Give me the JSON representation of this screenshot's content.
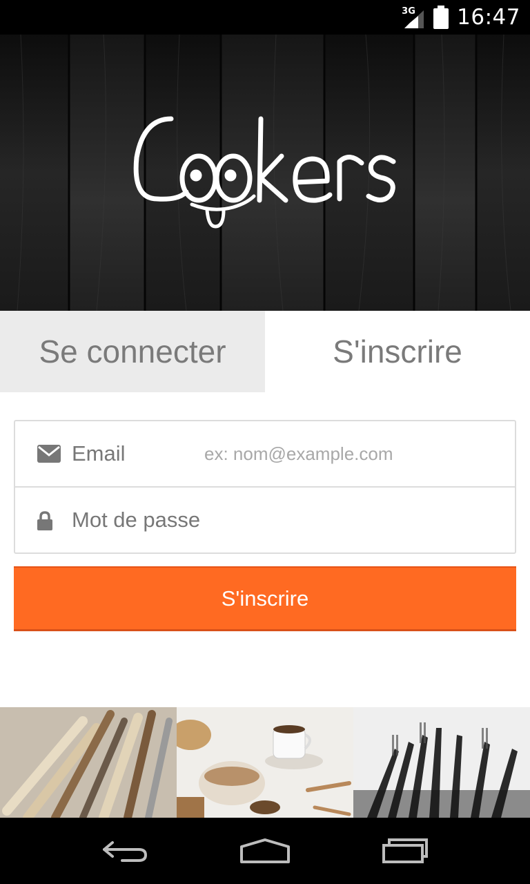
{
  "status_bar": {
    "network": "3G",
    "time": "16:47"
  },
  "brand": {
    "name": "Cookers"
  },
  "tabs": [
    {
      "label": "Se connecter",
      "selected": false
    },
    {
      "label": "S'inscrire",
      "selected": true
    }
  ],
  "form": {
    "email": {
      "label": "Email",
      "placeholder": "ex: nom@example.com",
      "icon": "envelope-icon"
    },
    "password": {
      "placeholder": "Mot de passe",
      "icon": "lock-icon"
    },
    "submit_label": "S'inscrire"
  },
  "colors": {
    "accent": "#ff6a22",
    "inactive_tab": "#ebebeb",
    "text_gray": "#7a7a7a"
  },
  "photos": [
    {
      "subject": "vintage cutlery knives"
    },
    {
      "subject": "coffee cup, bread and wooden spoons"
    },
    {
      "subject": "black and white forks"
    }
  ],
  "nav": {
    "back_icon": "back-icon",
    "home_icon": "home-icon",
    "recents_icon": "recents-icon"
  }
}
